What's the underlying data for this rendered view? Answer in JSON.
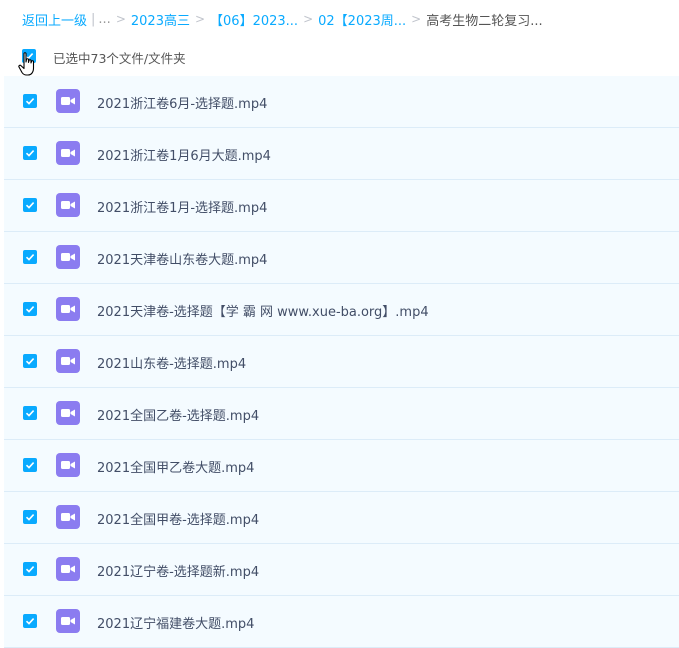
{
  "breadcrumb": {
    "back": "返回上一级",
    "separator_bar": "|",
    "ellipsis": "...",
    "sep": ">",
    "items": [
      {
        "label": "2023高三"
      },
      {
        "label": "【06】2023..."
      },
      {
        "label": "02【2023周..."
      }
    ],
    "current": "高考生物二轮复习..."
  },
  "selection": {
    "summary": "已选中73个文件/文件夹",
    "checked": true
  },
  "files": [
    {
      "name": "2021浙江卷6月-选择题.mp4",
      "icon": "video-file-icon",
      "checked": true
    },
    {
      "name": "2021浙江卷1月6月大题.mp4",
      "icon": "video-file-icon",
      "checked": true
    },
    {
      "name": "2021浙江卷1月-选择题.mp4",
      "icon": "video-file-icon",
      "checked": true
    },
    {
      "name": "2021天津卷山东卷大题.mp4",
      "icon": "video-file-icon",
      "checked": true
    },
    {
      "name": "2021天津卷-选择题【学 霸 网 www.xue-ba.org】.mp4",
      "icon": "video-file-icon",
      "checked": true
    },
    {
      "name": "2021山东卷-选择题.mp4",
      "icon": "video-file-icon",
      "checked": true
    },
    {
      "name": "2021全国乙卷-选择题.mp4",
      "icon": "video-file-icon",
      "checked": true
    },
    {
      "name": "2021全国甲乙卷大题.mp4",
      "icon": "video-file-icon",
      "checked": true
    },
    {
      "name": "2021全国甲卷-选择题.mp4",
      "icon": "video-file-icon",
      "checked": true
    },
    {
      "name": "2021辽宁卷-选择题新.mp4",
      "icon": "video-file-icon",
      "checked": true
    },
    {
      "name": "2021辽宁福建卷大题.mp4",
      "icon": "video-file-icon",
      "checked": true
    }
  ],
  "colors": {
    "accent": "#09aaff",
    "video_icon": "#8b7cf0",
    "row_bg": "#f4fbff"
  }
}
